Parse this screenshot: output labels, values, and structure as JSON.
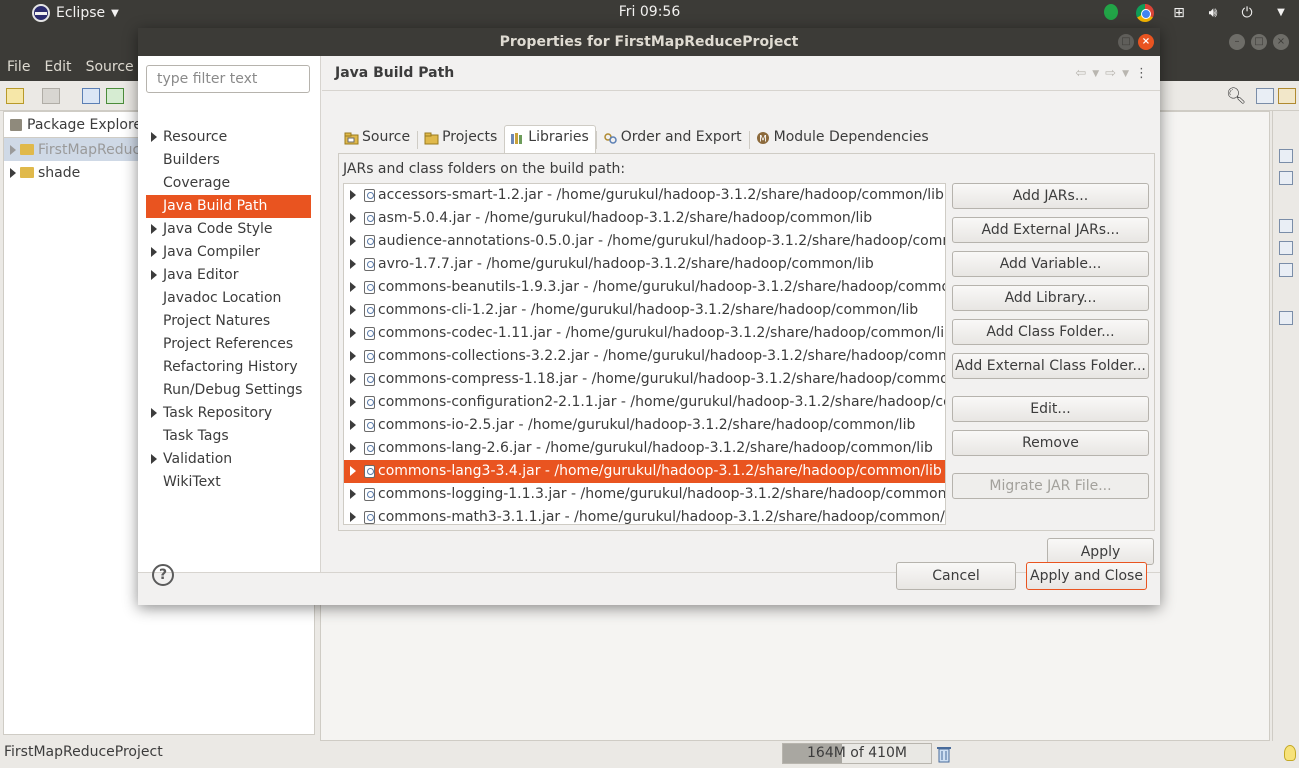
{
  "topbar": {
    "app_name": "Eclipse",
    "clock": "Fri 09:56"
  },
  "eclipse": {
    "menus": [
      "File",
      "Edit",
      "Source"
    ],
    "package_explorer": {
      "tab_label": "Package Explore",
      "items": [
        {
          "label": "FirstMapReduc"
        },
        {
          "label": "shade"
        }
      ]
    },
    "status": {
      "project": "FirstMapReduceProject",
      "heap": "164M of 410M",
      "heap_used_fraction": 0.4
    }
  },
  "dialog": {
    "title": "Properties for FirstMapReduceProject",
    "filter_placeholder": "type filter text",
    "nav": [
      {
        "label": "Resource",
        "expandable": true
      },
      {
        "label": "Builders",
        "expandable": false
      },
      {
        "label": "Coverage",
        "expandable": false
      },
      {
        "label": "Java Build Path",
        "expandable": false,
        "selected": true
      },
      {
        "label": "Java Code Style",
        "expandable": true
      },
      {
        "label": "Java Compiler",
        "expandable": true
      },
      {
        "label": "Java Editor",
        "expandable": true
      },
      {
        "label": "Javadoc Location",
        "expandable": false
      },
      {
        "label": "Project Natures",
        "expandable": false
      },
      {
        "label": "Project References",
        "expandable": false
      },
      {
        "label": "Refactoring History",
        "expandable": false
      },
      {
        "label": "Run/Debug Settings",
        "expandable": false
      },
      {
        "label": "Task Repository",
        "expandable": true
      },
      {
        "label": "Task Tags",
        "expandable": false
      },
      {
        "label": "Validation",
        "expandable": true
      },
      {
        "label": "WikiText",
        "expandable": false
      }
    ],
    "page_title": "Java Build Path",
    "tabs": [
      {
        "label": "Source"
      },
      {
        "label": "Projects"
      },
      {
        "label": "Libraries",
        "active": true
      },
      {
        "label": "Order and Export"
      },
      {
        "label": "Module Dependencies"
      }
    ],
    "jar_list_label": "JARs and class folders on the build path:",
    "jars": [
      "accessors-smart-1.2.jar - /home/gurukul/hadoop-3.1.2/share/hadoop/common/lib",
      "asm-5.0.4.jar - /home/gurukul/hadoop-3.1.2/share/hadoop/common/lib",
      "audience-annotations-0.5.0.jar - /home/gurukul/hadoop-3.1.2/share/hadoop/commor",
      "avro-1.7.7.jar - /home/gurukul/hadoop-3.1.2/share/hadoop/common/lib",
      "commons-beanutils-1.9.3.jar - /home/gurukul/hadoop-3.1.2/share/hadoop/common/",
      "commons-cli-1.2.jar - /home/gurukul/hadoop-3.1.2/share/hadoop/common/lib",
      "commons-codec-1.11.jar - /home/gurukul/hadoop-3.1.2/share/hadoop/common/lib",
      "commons-collections-3.2.2.jar - /home/gurukul/hadoop-3.1.2/share/hadoop/commor",
      "commons-compress-1.18.jar - /home/gurukul/hadoop-3.1.2/share/hadoop/common/",
      "commons-configuration2-2.1.1.jar - /home/gurukul/hadoop-3.1.2/share/hadoop/com",
      "commons-io-2.5.jar - /home/gurukul/hadoop-3.1.2/share/hadoop/common/lib",
      "commons-lang-2.6.jar - /home/gurukul/hadoop-3.1.2/share/hadoop/common/lib",
      "commons-lang3-3.4.jar - /home/gurukul/hadoop-3.1.2/share/hadoop/common/lib",
      "commons-logging-1.1.3.jar - /home/gurukul/hadoop-3.1.2/share/hadoop/common/lib",
      "commons-math3-3.1.1.jar - /home/gurukul/hadoop-3.1.2/share/hadoop/common/lib"
    ],
    "selected_jar_index": 12,
    "buttons": {
      "add_jars": "Add JARs...",
      "add_external_jars": "Add External JARs...",
      "add_variable": "Add Variable...",
      "add_library": "Add Library...",
      "add_class_folder": "Add Class Folder...",
      "add_external_class_folder": "Add External Class Folder...",
      "edit": "Edit...",
      "remove": "Remove",
      "migrate_jar": "Migrate JAR File...",
      "apply": "Apply",
      "cancel": "Cancel",
      "apply_and_close": "Apply and Close"
    },
    "help_glyph": "?"
  },
  "colors": {
    "accent": "#e95420",
    "titlebar": "#3c3b37"
  }
}
